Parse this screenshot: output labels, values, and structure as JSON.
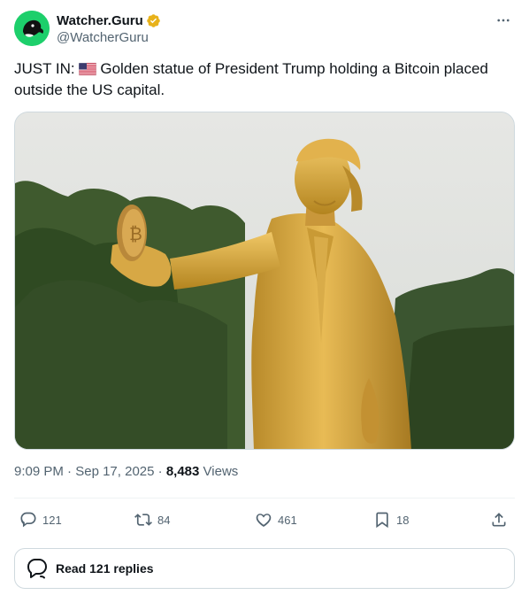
{
  "author": {
    "display_name": "Watcher.Guru",
    "handle": "@WatcherGuru",
    "avatar_icon": "watcher-guru-logo-icon",
    "verified_color": "#e8b21a",
    "avatar_color": "#1dcf6b"
  },
  "tweet": {
    "prefix": "JUST IN:",
    "flag_icon": "us-flag-icon",
    "body": "Golden statue of President Trump holding a Bitcoin placed outside the US capital."
  },
  "meta": {
    "time": "9:09 PM",
    "date": "Sep 17, 2025",
    "views_count": "8,483",
    "views_label": "Views"
  },
  "actions": {
    "replies": "121",
    "reposts": "84",
    "likes": "461",
    "bookmarks": "18"
  },
  "read_replies": {
    "label": "Read 121 replies"
  }
}
